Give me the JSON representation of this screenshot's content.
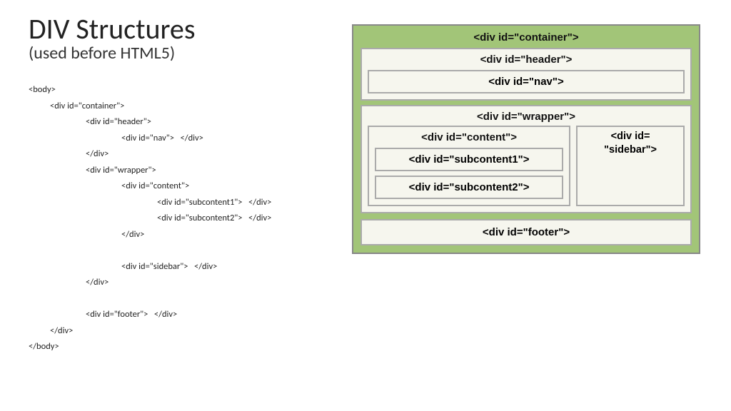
{
  "title": "DIV Structures",
  "subtitle": "(used before HTML5)",
  "code": [
    {
      "cls": "",
      "t": "<body>"
    },
    {
      "cls": "ind1",
      "t": "<div id=\"container\">"
    },
    {
      "cls": "ind2",
      "t": "<div id=\"header\">"
    },
    {
      "cls": "ind3",
      "t": "<div id=\"nav\">   </div>"
    },
    {
      "cls": "ind2",
      "t": "</div>"
    },
    {
      "cls": "ind2",
      "t": "<div id=\"wrapper\">"
    },
    {
      "cls": "ind3",
      "t": "<div id=\"content\">"
    },
    {
      "cls": "ind4",
      "t": "<div id=\"subcontent1\">   </div>"
    },
    {
      "cls": "ind4",
      "t": "<div id=\"subcontent2\">   </div>"
    },
    {
      "cls": "ind3",
      "t": "</div>"
    },
    {
      "cls": "ind3",
      "t": ""
    },
    {
      "cls": "ind3",
      "t": "<div id=\"sidebar\">   </div>"
    },
    {
      "cls": "ind2",
      "t": "</div>"
    },
    {
      "cls": "ind2",
      "t": ""
    },
    {
      "cls": "ind2",
      "t": "<div id=\"footer\">   </div>"
    },
    {
      "cls": "ind1",
      "t": "</div>"
    },
    {
      "cls": "",
      "t": "</body>"
    }
  ],
  "diagram": {
    "container": "<div id=\"container\">",
    "header": "<div id=\"header\">",
    "nav": "<div id=\"nav\">",
    "wrapper": "<div id=\"wrapper\">",
    "content": "<div id=\"content\">",
    "subcontent1": "<div id=\"subcontent1\">",
    "subcontent2": "<div id=\"subcontent2\">",
    "sidebar_l1": "<div id=",
    "sidebar_l2": "\"sidebar\">",
    "footer": "<div id=\"footer\">"
  }
}
